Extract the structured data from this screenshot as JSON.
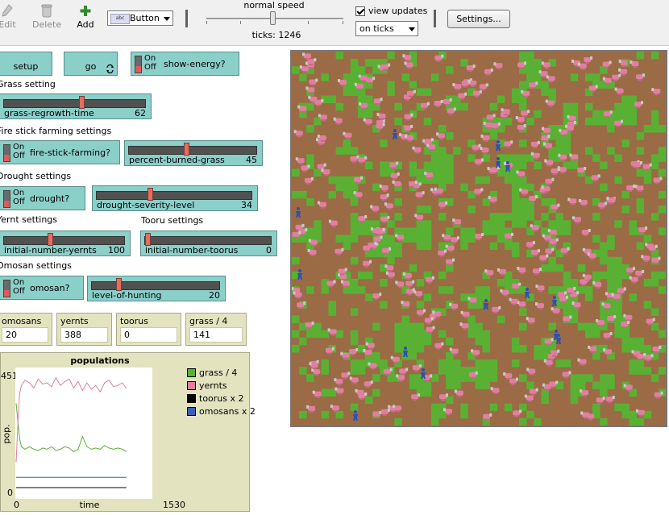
{
  "toolbar": {
    "edit_label": "Edit",
    "delete_label": "Delete",
    "add_label": "Add",
    "widget_type": "Button",
    "speed_label": "normal speed",
    "ticks_label": "ticks: 1246",
    "view_updates_label": "view updates",
    "view_updates_checked": true,
    "update_mode": "on ticks",
    "settings_label": "Settings..."
  },
  "buttons": {
    "setup": "setup",
    "go": "go"
  },
  "switches": {
    "on_label": "On",
    "off_label": "Off",
    "show_energy": "show-energy?",
    "fire_stick": "fire-stick-farming?",
    "drought": "drought?",
    "omosan": "omosan?"
  },
  "notes": {
    "grass": "Grass setting",
    "fire": "Fire stick farming settings",
    "drought": "Drought settings",
    "yernt": "Yernt settings",
    "tooru": "Tooru settings",
    "omosan": "Omosan settings"
  },
  "sliders": [
    {
      "name": "grass-regrowth-time",
      "value": "62",
      "fraction": 0.55
    },
    {
      "name": "percent-burned-grass",
      "value": "45",
      "fraction": 0.45
    },
    {
      "name": "drought-severity-level",
      "value": "34",
      "fraction": 0.34
    },
    {
      "name": "initial-number-yernts",
      "value": "100",
      "fraction": 0.38
    },
    {
      "name": "initial-number-toorus",
      "value": "0",
      "fraction": 0.0
    },
    {
      "name": "level-of-hunting",
      "value": "20",
      "fraction": 0.2
    }
  ],
  "monitors": [
    {
      "name": "omosans",
      "value": "20"
    },
    {
      "name": "yernts",
      "value": "388"
    },
    {
      "name": "toorus",
      "value": "0"
    },
    {
      "name": "grass / 4",
      "value": "141"
    }
  ],
  "chart_data": {
    "type": "line",
    "title": "populations",
    "xlabel": "time",
    "ylabel": "pop.",
    "xlim": [
      0,
      1530
    ],
    "ylim": [
      0,
      451
    ],
    "x_tick_labels": [
      "0",
      "1530"
    ],
    "y_tick_labels": [
      "0",
      "451"
    ],
    "legend": "right",
    "series": [
      {
        "name": "grass / 4",
        "color": "#59b033",
        "x": [
          0,
          20,
          40,
          60,
          100,
          150,
          200,
          250,
          300,
          350,
          400,
          450,
          500,
          550,
          600,
          650,
          700,
          750,
          800,
          850,
          900,
          950,
          1000,
          1050,
          1100,
          1150,
          1200,
          1246
        ],
        "y": [
          330,
          260,
          190,
          160,
          150,
          160,
          150,
          145,
          155,
          150,
          160,
          145,
          150,
          160,
          155,
          140,
          150,
          200,
          160,
          150,
          155,
          150,
          165,
          155,
          150,
          155,
          150,
          141
        ]
      },
      {
        "name": "yernts",
        "color": "#de7f9e",
        "x": [
          0,
          20,
          40,
          60,
          100,
          150,
          200,
          250,
          300,
          350,
          400,
          450,
          500,
          550,
          600,
          650,
          700,
          750,
          800,
          850,
          900,
          950,
          1000,
          1050,
          1100,
          1150,
          1200,
          1246
        ],
        "y": [
          100,
          250,
          370,
          400,
          420,
          410,
          390,
          425,
          405,
          410,
          395,
          430,
          400,
          415,
          425,
          390,
          415,
          380,
          410,
          385,
          400,
          375,
          410,
          420,
          395,
          400,
          410,
          388
        ]
      },
      {
        "name": "toorus x 2",
        "color": "#000000",
        "x": [
          0,
          1246
        ],
        "y": [
          0,
          0
        ]
      },
      {
        "name": "omosans x 2",
        "color": "#3c5fb6",
        "x": [
          0,
          1246
        ],
        "y": [
          40,
          40
        ]
      }
    ]
  }
}
